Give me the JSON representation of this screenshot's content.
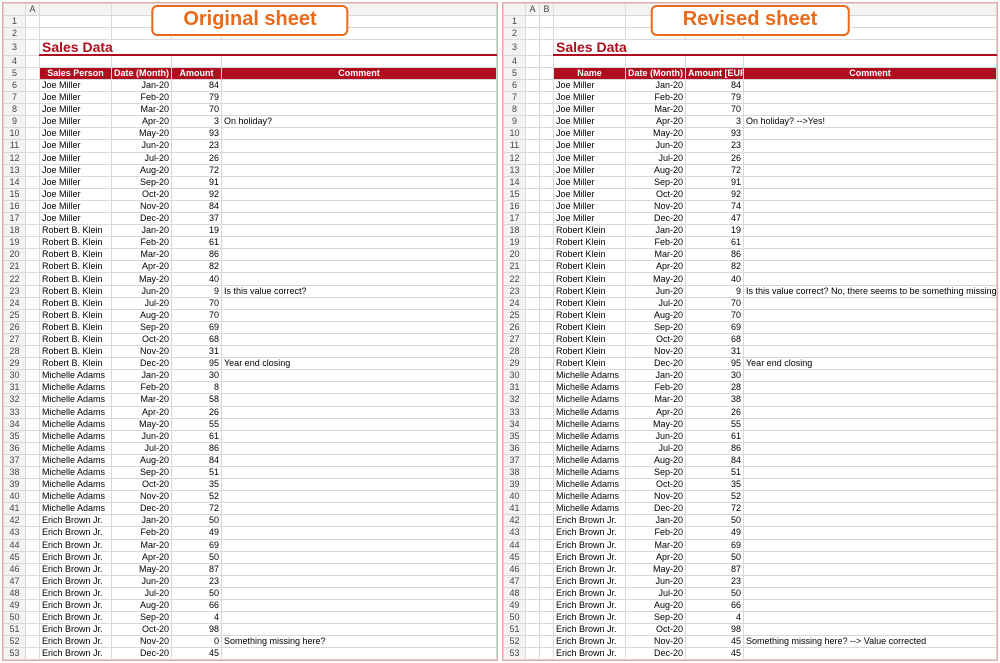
{
  "panels": {
    "original": {
      "caption": "Original sheet",
      "title": "Sales Data",
      "col_letters": [
        "A"
      ],
      "headers": [
        "Sales Person",
        "Date (Month)",
        "Amount",
        "Comment"
      ],
      "rows": [
        {
          "p": "Joe Miller",
          "m": "Jan-20",
          "a": 84,
          "c": ""
        },
        {
          "p": "Joe Miller",
          "m": "Feb-20",
          "a": 79,
          "c": ""
        },
        {
          "p": "Joe Miller",
          "m": "Mar-20",
          "a": 70,
          "c": ""
        },
        {
          "p": "Joe Miller",
          "m": "Apr-20",
          "a": 3,
          "c": "On holiday?"
        },
        {
          "p": "Joe Miller",
          "m": "May-20",
          "a": 93,
          "c": ""
        },
        {
          "p": "Joe Miller",
          "m": "Jun-20",
          "a": 23,
          "c": ""
        },
        {
          "p": "Joe Miller",
          "m": "Jul-20",
          "a": 26,
          "c": ""
        },
        {
          "p": "Joe Miller",
          "m": "Aug-20",
          "a": 72,
          "c": ""
        },
        {
          "p": "Joe Miller",
          "m": "Sep-20",
          "a": 91,
          "c": ""
        },
        {
          "p": "Joe Miller",
          "m": "Oct-20",
          "a": 92,
          "c": ""
        },
        {
          "p": "Joe Miller",
          "m": "Nov-20",
          "a": 84,
          "c": ""
        },
        {
          "p": "Joe Miller",
          "m": "Dec-20",
          "a": 37,
          "c": ""
        },
        {
          "p": "Robert B. Klein",
          "m": "Jan-20",
          "a": 19,
          "c": ""
        },
        {
          "p": "Robert B. Klein",
          "m": "Feb-20",
          "a": 61,
          "c": ""
        },
        {
          "p": "Robert B. Klein",
          "m": "Mar-20",
          "a": 86,
          "c": ""
        },
        {
          "p": "Robert B. Klein",
          "m": "Apr-20",
          "a": 82,
          "c": ""
        },
        {
          "p": "Robert B. Klein",
          "m": "May-20",
          "a": 40,
          "c": ""
        },
        {
          "p": "Robert B. Klein",
          "m": "Jun-20",
          "a": 9,
          "c": "Is this value correct?"
        },
        {
          "p": "Robert B. Klein",
          "m": "Jul-20",
          "a": 70,
          "c": ""
        },
        {
          "p": "Robert B. Klein",
          "m": "Aug-20",
          "a": 70,
          "c": ""
        },
        {
          "p": "Robert B. Klein",
          "m": "Sep-20",
          "a": 69,
          "c": ""
        },
        {
          "p": "Robert B. Klein",
          "m": "Oct-20",
          "a": 68,
          "c": ""
        },
        {
          "p": "Robert B. Klein",
          "m": "Nov-20",
          "a": 31,
          "c": ""
        },
        {
          "p": "Robert B. Klein",
          "m": "Dec-20",
          "a": 95,
          "c": "Year end closing"
        },
        {
          "p": "Michelle Adams",
          "m": "Jan-20",
          "a": 30,
          "c": ""
        },
        {
          "p": "Michelle Adams",
          "m": "Feb-20",
          "a": 8,
          "c": ""
        },
        {
          "p": "Michelle Adams",
          "m": "Mar-20",
          "a": 58,
          "c": ""
        },
        {
          "p": "Michelle Adams",
          "m": "Apr-20",
          "a": 26,
          "c": ""
        },
        {
          "p": "Michelle Adams",
          "m": "May-20",
          "a": 55,
          "c": ""
        },
        {
          "p": "Michelle Adams",
          "m": "Jun-20",
          "a": 61,
          "c": ""
        },
        {
          "p": "Michelle Adams",
          "m": "Jul-20",
          "a": 86,
          "c": ""
        },
        {
          "p": "Michelle Adams",
          "m": "Aug-20",
          "a": 84,
          "c": ""
        },
        {
          "p": "Michelle Adams",
          "m": "Sep-20",
          "a": 51,
          "c": ""
        },
        {
          "p": "Michelle Adams",
          "m": "Oct-20",
          "a": 35,
          "c": ""
        },
        {
          "p": "Michelle Adams",
          "m": "Nov-20",
          "a": 52,
          "c": ""
        },
        {
          "p": "Michelle Adams",
          "m": "Dec-20",
          "a": 72,
          "c": ""
        },
        {
          "p": "Erich Brown Jr.",
          "m": "Jan-20",
          "a": 50,
          "c": ""
        },
        {
          "p": "Erich Brown Jr.",
          "m": "Feb-20",
          "a": 49,
          "c": ""
        },
        {
          "p": "Erich Brown Jr.",
          "m": "Mar-20",
          "a": 69,
          "c": ""
        },
        {
          "p": "Erich Brown Jr.",
          "m": "Apr-20",
          "a": 50,
          "c": ""
        },
        {
          "p": "Erich Brown Jr.",
          "m": "May-20",
          "a": 87,
          "c": ""
        },
        {
          "p": "Erich Brown Jr.",
          "m": "Jun-20",
          "a": 23,
          "c": ""
        },
        {
          "p": "Erich Brown Jr.",
          "m": "Jul-20",
          "a": 50,
          "c": ""
        },
        {
          "p": "Erich Brown Jr.",
          "m": "Aug-20",
          "a": 66,
          "c": ""
        },
        {
          "p": "Erich Brown Jr.",
          "m": "Sep-20",
          "a": 4,
          "c": ""
        },
        {
          "p": "Erich Brown Jr.",
          "m": "Oct-20",
          "a": 98,
          "c": ""
        },
        {
          "p": "Erich Brown Jr.",
          "m": "Nov-20",
          "a": 0,
          "c": "Something missing here?"
        },
        {
          "p": "Erich Brown Jr.",
          "m": "Dec-20",
          "a": 45,
          "c": ""
        }
      ]
    },
    "revised": {
      "caption": "Revised sheet",
      "title": "Sales Data",
      "col_letters": [
        "A",
        "B"
      ],
      "headers": [
        "Name",
        "Date (Month)",
        "Amount [EUR]",
        "Comment"
      ],
      "rows": [
        {
          "p": "Joe Miller",
          "m": "Jan-20",
          "a": 84,
          "c": ""
        },
        {
          "p": "Joe Miller",
          "m": "Feb-20",
          "a": 79,
          "c": ""
        },
        {
          "p": "Joe Miller",
          "m": "Mar-20",
          "a": 70,
          "c": ""
        },
        {
          "p": "Joe Miller",
          "m": "Apr-20",
          "a": 3,
          "c": "On holiday? -->Yes!"
        },
        {
          "p": "Joe Miller",
          "m": "May-20",
          "a": 93,
          "c": ""
        },
        {
          "p": "Joe Miller",
          "m": "Jun-20",
          "a": 23,
          "c": ""
        },
        {
          "p": "Joe Miller",
          "m": "Jul-20",
          "a": 26,
          "c": ""
        },
        {
          "p": "Joe Miller",
          "m": "Aug-20",
          "a": 72,
          "c": ""
        },
        {
          "p": "Joe Miller",
          "m": "Sep-20",
          "a": 91,
          "c": ""
        },
        {
          "p": "Joe Miller",
          "m": "Oct-20",
          "a": 92,
          "c": ""
        },
        {
          "p": "Joe Miller",
          "m": "Nov-20",
          "a": 74,
          "c": ""
        },
        {
          "p": "Joe Miller",
          "m": "Dec-20",
          "a": 47,
          "c": ""
        },
        {
          "p": "Robert Klein",
          "m": "Jan-20",
          "a": 19,
          "c": ""
        },
        {
          "p": "Robert Klein",
          "m": "Feb-20",
          "a": 61,
          "c": ""
        },
        {
          "p": "Robert Klein",
          "m": "Mar-20",
          "a": 86,
          "c": ""
        },
        {
          "p": "Robert Klein",
          "m": "Apr-20",
          "a": 82,
          "c": ""
        },
        {
          "p": "Robert Klein",
          "m": "May-20",
          "a": 40,
          "c": ""
        },
        {
          "p": "Robert Klein",
          "m": "Jun-20",
          "a": 9,
          "c": "Is this value correct? No, there seems to be something missing"
        },
        {
          "p": "Robert Klein",
          "m": "Jul-20",
          "a": 70,
          "c": ""
        },
        {
          "p": "Robert Klein",
          "m": "Aug-20",
          "a": 70,
          "c": ""
        },
        {
          "p": "Robert Klein",
          "m": "Sep-20",
          "a": 69,
          "c": ""
        },
        {
          "p": "Robert Klein",
          "m": "Oct-20",
          "a": 68,
          "c": ""
        },
        {
          "p": "Robert Klein",
          "m": "Nov-20",
          "a": 31,
          "c": ""
        },
        {
          "p": "Robert Klein",
          "m": "Dec-20",
          "a": 95,
          "c": "Year end closing"
        },
        {
          "p": "Michelle Adams",
          "m": "Jan-20",
          "a": 30,
          "c": ""
        },
        {
          "p": "Michelle Adams",
          "m": "Feb-20",
          "a": 28,
          "c": ""
        },
        {
          "p": "Michelle Adams",
          "m": "Mar-20",
          "a": 38,
          "c": ""
        },
        {
          "p": "Michelle Adams",
          "m": "Apr-20",
          "a": 26,
          "c": ""
        },
        {
          "p": "Michelle Adams",
          "m": "May-20",
          "a": 55,
          "c": ""
        },
        {
          "p": "Michelle Adams",
          "m": "Jun-20",
          "a": 61,
          "c": ""
        },
        {
          "p": "Michelle Adams",
          "m": "Jul-20",
          "a": 86,
          "c": ""
        },
        {
          "p": "Michelle Adams",
          "m": "Aug-20",
          "a": 84,
          "c": ""
        },
        {
          "p": "Michelle Adams",
          "m": "Sep-20",
          "a": 51,
          "c": ""
        },
        {
          "p": "Michelle Adams",
          "m": "Oct-20",
          "a": 35,
          "c": ""
        },
        {
          "p": "Michelle Adams",
          "m": "Nov-20",
          "a": 52,
          "c": ""
        },
        {
          "p": "Michelle Adams",
          "m": "Dec-20",
          "a": 72,
          "c": ""
        },
        {
          "p": "Erich Brown Jr.",
          "m": "Jan-20",
          "a": 50,
          "c": ""
        },
        {
          "p": "Erich Brown Jr.",
          "m": "Feb-20",
          "a": 49,
          "c": ""
        },
        {
          "p": "Erich Brown Jr.",
          "m": "Mar-20",
          "a": 69,
          "c": ""
        },
        {
          "p": "Erich Brown Jr.",
          "m": "Apr-20",
          "a": 50,
          "c": ""
        },
        {
          "p": "Erich Brown Jr.",
          "m": "May-20",
          "a": 87,
          "c": ""
        },
        {
          "p": "Erich Brown Jr.",
          "m": "Jun-20",
          "a": 23,
          "c": ""
        },
        {
          "p": "Erich Brown Jr.",
          "m": "Jul-20",
          "a": 50,
          "c": ""
        },
        {
          "p": "Erich Brown Jr.",
          "m": "Aug-20",
          "a": 66,
          "c": ""
        },
        {
          "p": "Erich Brown Jr.",
          "m": "Sep-20",
          "a": 4,
          "c": ""
        },
        {
          "p": "Erich Brown Jr.",
          "m": "Oct-20",
          "a": 98,
          "c": ""
        },
        {
          "p": "Erich Brown Jr.",
          "m": "Nov-20",
          "a": 45,
          "c": "Something missing here? --> Value corrected"
        },
        {
          "p": "Erich Brown Jr.",
          "m": "Dec-20",
          "a": 45,
          "c": ""
        }
      ]
    }
  }
}
